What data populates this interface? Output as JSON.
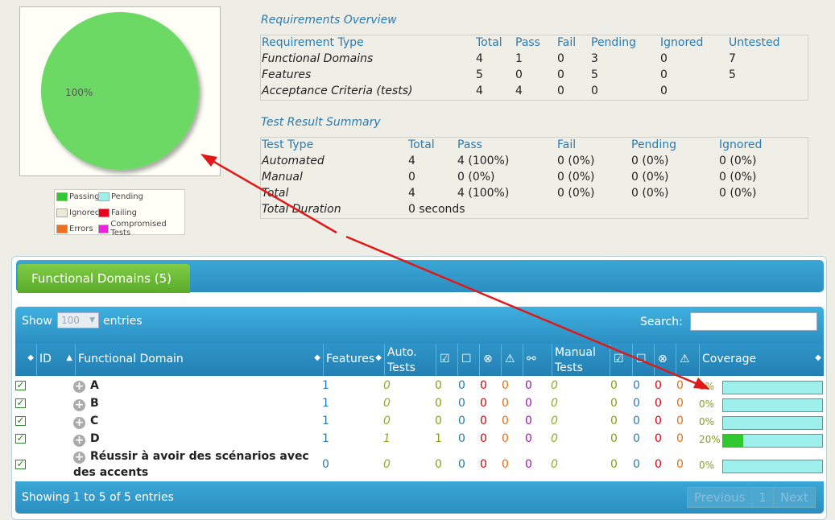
{
  "pie": {
    "label": "100%",
    "legend": [
      {
        "label": "Passing",
        "color": "#2fc92f"
      },
      {
        "label": "Pending",
        "color": "#9df0ec"
      },
      {
        "label": "Ignored",
        "color": "#ece8da"
      },
      {
        "label": "Failing",
        "color": "#e8001c"
      },
      {
        "label": "Errors",
        "color": "#f07020"
      },
      {
        "label": "Compromised Tests",
        "color": "#f020e0"
      }
    ]
  },
  "requirements": {
    "title": "Requirements Overview",
    "headers": [
      "Requirement Type",
      "Total",
      "Pass",
      "Fail",
      "Pending",
      "Ignored",
      "Untested"
    ],
    "rows": [
      [
        "Functional Domains",
        "4",
        "1",
        "0",
        "3",
        "0",
        "7"
      ],
      [
        "Features",
        "5",
        "0",
        "0",
        "5",
        "0",
        "5"
      ],
      [
        "Acceptance Criteria (tests)",
        "4",
        "4",
        "0",
        "0",
        "0",
        ""
      ]
    ]
  },
  "results": {
    "title": "Test Result Summary",
    "headers": [
      "Test Type",
      "Total",
      "Pass",
      "Fail",
      "Pending",
      "Ignored"
    ],
    "rows": [
      [
        "Automated",
        "4",
        "4 (100%)",
        "0 (0%)",
        "0 (0%)",
        "0 (0%)"
      ],
      [
        "Manual",
        "0",
        "0 (0%)",
        "0 (0%)",
        "0 (0%)",
        "0 (0%)"
      ],
      [
        "Total",
        "4",
        "4 (100%)",
        "0 (0%)",
        "0 (0%)",
        "0 (0%)"
      ]
    ],
    "duration_label": "Total Duration",
    "duration_value": "0 seconds"
  },
  "domains": {
    "tab_label": "Functional Domains (5)",
    "show_label": "Show",
    "entries_value": "100",
    "entries_label": "entries",
    "search_label": "Search:",
    "search_value": "",
    "columns": {
      "id": "ID",
      "domain": "Functional Domain",
      "features": "Features",
      "auto_tests_1": "Auto.",
      "auto_tests_2": "Tests",
      "manual_tests_1": "Manual",
      "manual_tests_2": "Tests",
      "coverage": "Coverage"
    },
    "rows": [
      {
        "name": "A",
        "features": "1",
        "auto": "0",
        "a_pass": "0",
        "a_pend": "0",
        "a_fail": "0",
        "a_err": "0",
        "a_comp": "0",
        "manual": "0",
        "m_pass": "0",
        "m_pend": "0",
        "m_fail": "0",
        "m_err": "0",
        "coverage": "0%",
        "coverage_value": 0
      },
      {
        "name": "B",
        "features": "1",
        "auto": "0",
        "a_pass": "0",
        "a_pend": "0",
        "a_fail": "0",
        "a_err": "0",
        "a_comp": "0",
        "manual": "0",
        "m_pass": "0",
        "m_pend": "0",
        "m_fail": "0",
        "m_err": "0",
        "coverage": "0%",
        "coverage_value": 0
      },
      {
        "name": "C",
        "features": "1",
        "auto": "0",
        "a_pass": "0",
        "a_pend": "0",
        "a_fail": "0",
        "a_err": "0",
        "a_comp": "0",
        "manual": "0",
        "m_pass": "0",
        "m_pend": "0",
        "m_fail": "0",
        "m_err": "0",
        "coverage": "0%",
        "coverage_value": 0
      },
      {
        "name": "D",
        "features": "1",
        "auto": "1",
        "a_pass": "1",
        "a_pend": "0",
        "a_fail": "0",
        "a_err": "0",
        "a_comp": "0",
        "manual": "0",
        "m_pass": "0",
        "m_pend": "0",
        "m_fail": "0",
        "m_err": "0",
        "coverage": "20%",
        "coverage_value": 20
      },
      {
        "name": "Réussir à avoir des scénarios avec des accents",
        "name_line1": "Réussir à avoir des scénarios avec",
        "name_line2": "des accents",
        "features": "0",
        "auto": "0",
        "a_pass": "0",
        "a_pend": "0",
        "a_fail": "0",
        "a_err": "0",
        "a_comp": "0",
        "manual": "0",
        "m_pass": "0",
        "m_pend": "0",
        "m_fail": "0",
        "m_err": "0",
        "coverage": "0%",
        "coverage_value": 0
      }
    ],
    "footer_info": "Showing 1 to 5 of 5 entries",
    "pager": {
      "previous": "Previous",
      "page": "1",
      "next": "Next"
    }
  }
}
